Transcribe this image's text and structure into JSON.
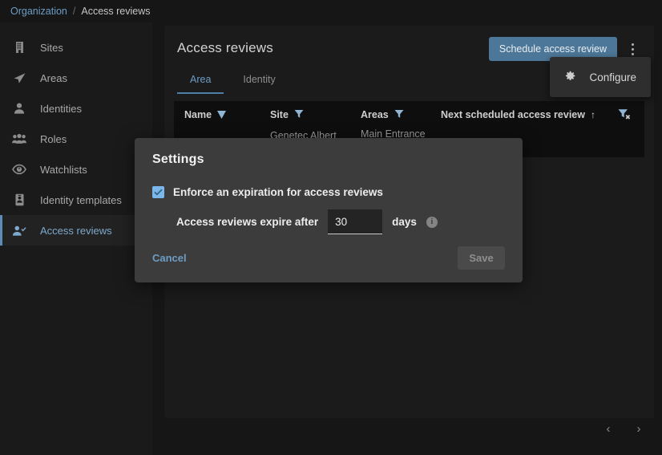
{
  "breadcrumb": {
    "root": "Organization",
    "separator": "/",
    "current": "Access reviews"
  },
  "sidebar": {
    "items": [
      {
        "label": "Sites",
        "icon": "building-icon",
        "selected": false
      },
      {
        "label": "Areas",
        "icon": "navigation-arrow-icon",
        "selected": false
      },
      {
        "label": "Identities",
        "icon": "person-icon",
        "selected": false
      },
      {
        "label": "Roles",
        "icon": "people-group-icon",
        "selected": false
      },
      {
        "label": "Watchlists",
        "icon": "eye-icon",
        "selected": false
      },
      {
        "label": "Identity templates",
        "icon": "id-card-icon",
        "selected": false
      },
      {
        "label": "Access reviews",
        "icon": "person-check-icon",
        "selected": true
      }
    ]
  },
  "main": {
    "title": "Access reviews",
    "schedule_button": "Schedule access review",
    "kebab_icon": "more-vertical-icon",
    "tabs": [
      {
        "label": "Area",
        "active": true
      },
      {
        "label": "Identity",
        "active": false
      }
    ],
    "configure_menu": {
      "items": [
        {
          "label": "Configure",
          "icon": "gear-icon"
        }
      ]
    },
    "table": {
      "columns": [
        {
          "label": "Name",
          "icon": "sort-descending-icon"
        },
        {
          "label": "Site",
          "icon": "filter-funnel-icon"
        },
        {
          "label": "Areas",
          "icon": "filter-funnel-icon"
        },
        {
          "label": "Next scheduled access review",
          "icon": "sort-ascending-arrow"
        }
      ],
      "clear_filter_icon": "clear-filter-icon",
      "rows": [
        {
          "name": "",
          "site": "Genetec Albert",
          "areas": "Main Entrance",
          "next_scheduled": ""
        }
      ]
    },
    "pagination": {
      "previous_icon": "chevron-left-icon",
      "next_icon": "chevron-right-icon"
    }
  },
  "modal": {
    "title": "Settings",
    "checkbox": {
      "label": "Enforce an expiration for access reviews",
      "checked": true,
      "icon": "checkmark-icon"
    },
    "expire_field": {
      "label": "Access reviews expire after",
      "value": "30",
      "unit": "days",
      "info_icon": "info-icon",
      "info_glyph": "i"
    },
    "cancel_label": "Cancel",
    "save_label": "Save"
  },
  "colors": {
    "accent_blue": "#6d9dc5",
    "button_blue": "#4d7798",
    "checkbox_blue": "#7ab8ec",
    "modal_bg": "#3c3c3c",
    "panel_bg": "#1b1b1b",
    "page_bg": "#161616",
    "sidebar_bg": "#1a1a1a",
    "table_bg": "#0e0e0e"
  }
}
